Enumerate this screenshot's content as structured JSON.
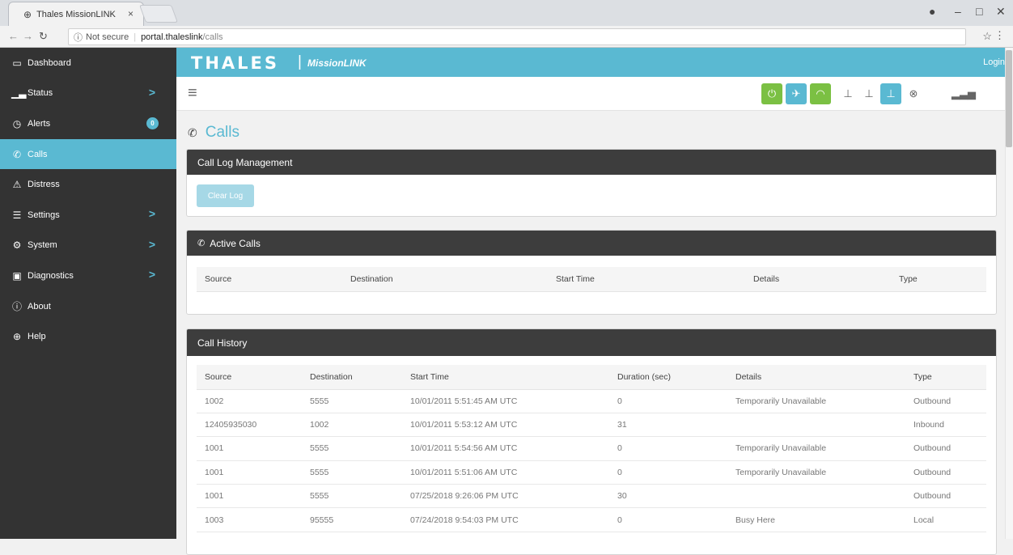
{
  "browser": {
    "tab_title": "Thales MissionLINK",
    "tab_close": "×",
    "security": "Not secure",
    "host": "portal.thaleslink",
    "path": "/calls"
  },
  "sidebar": {
    "items": [
      {
        "label": "Dashboard",
        "icon": "monitor-icon"
      },
      {
        "label": "Status",
        "icon": "chart-icon",
        "chevron": ">"
      },
      {
        "label": "Alerts",
        "icon": "alarm-icon",
        "badge": "0"
      },
      {
        "label": "Calls",
        "icon": "phone-icon",
        "active": true
      },
      {
        "label": "Distress",
        "icon": "warning-icon"
      },
      {
        "label": "Settings",
        "icon": "sliders-icon",
        "chevron": ">"
      },
      {
        "label": "System",
        "icon": "gear-icon",
        "chevron": ">"
      },
      {
        "label": "Diagnostics",
        "icon": "toolbox-icon",
        "chevron": ">"
      },
      {
        "label": "About",
        "icon": "info-icon"
      },
      {
        "label": "Help",
        "icon": "lifebuoy-icon"
      }
    ]
  },
  "header": {
    "brand": "THALES",
    "brand_sep": "|",
    "brand_sub": "MissionLINK",
    "login": "Login",
    "accent": "#5ab9d2",
    "status_green": "#7bc043"
  },
  "page": {
    "title": "Calls"
  },
  "call_log": {
    "title": "Call Log Management",
    "clear_label": "Clear Log"
  },
  "active_calls": {
    "title": "Active Calls",
    "headers": [
      "Source",
      "Destination",
      "Start Time",
      "Details",
      "Type"
    ]
  },
  "call_history": {
    "title": "Call History",
    "headers": [
      "Source",
      "Destination",
      "Start Time",
      "Duration (sec)",
      "Details",
      "Type"
    ],
    "rows": [
      [
        "1002",
        "5555",
        "10/01/2011 5:51:45 AM UTC",
        "0",
        "Temporarily Unavailable",
        "Outbound"
      ],
      [
        "12405935030",
        "1002",
        "10/01/2011 5:53:12 AM UTC",
        "31",
        "",
        "Inbound"
      ],
      [
        "1001",
        "5555",
        "10/01/2011 5:54:56 AM UTC",
        "0",
        "Temporarily Unavailable",
        "Outbound"
      ],
      [
        "1001",
        "5555",
        "10/01/2011 5:51:06 AM UTC",
        "0",
        "Temporarily Unavailable",
        "Outbound"
      ],
      [
        "1001",
        "5555",
        "07/25/2018 9:26:06 PM UTC",
        "30",
        "",
        "Outbound"
      ],
      [
        "1003",
        "95555",
        "07/24/2018 9:54:03 PM UTC",
        "0",
        "Busy Here",
        "Local"
      ]
    ]
  }
}
